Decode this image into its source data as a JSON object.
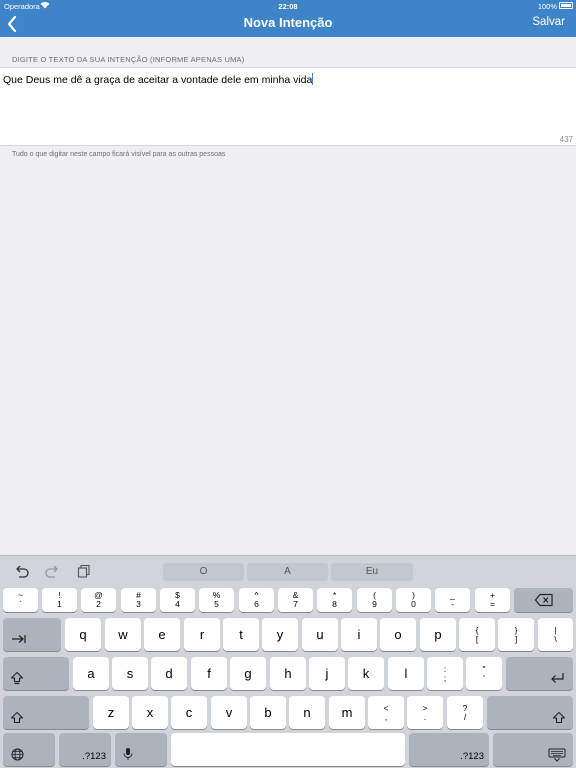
{
  "status_bar": {
    "carrier": "Operadora",
    "time": "22:08",
    "battery_percent": "100%"
  },
  "nav_bar": {
    "title": "Nova Intenção",
    "save_label": "Salvar"
  },
  "form": {
    "field_label": "DIGITE O TEXTO DA SUA INTENÇÃO (INFORME APENAS UMA)",
    "text_value": "Que Deus me dê a graça de aceitar a vontade dele em minha vida",
    "char_remaining": "437",
    "helper_text": "Tudo o que digitar neste campo ficará visível para as outras pessoas"
  },
  "keyboard": {
    "suggestions": [
      "O",
      "A",
      "Eu"
    ],
    "number_row": [
      {
        "top": "~",
        "bottom": "`"
      },
      {
        "top": "!",
        "bottom": "1"
      },
      {
        "top": "@",
        "bottom": "2"
      },
      {
        "top": "#",
        "bottom": "3"
      },
      {
        "top": "$",
        "bottom": "4"
      },
      {
        "top": "%",
        "bottom": "5"
      },
      {
        "top": "^",
        "bottom": "6"
      },
      {
        "top": "&",
        "bottom": "7"
      },
      {
        "top": "*",
        "bottom": "8"
      },
      {
        "top": "(",
        "bottom": "9"
      },
      {
        "top": ")",
        "bottom": "0"
      },
      {
        "top": "_",
        "bottom": "-"
      },
      {
        "top": "+",
        "bottom": "="
      }
    ],
    "row_q": [
      "q",
      "w",
      "e",
      "r",
      "t",
      "y",
      "u",
      "i",
      "o",
      "p"
    ],
    "row_q_extra": [
      {
        "top": "{",
        "bottom": "["
      },
      {
        "top": "}",
        "bottom": "]"
      },
      {
        "top": "|",
        "bottom": "\\"
      }
    ],
    "row_a": [
      "a",
      "s",
      "d",
      "f",
      "g",
      "h",
      "j",
      "k",
      "l"
    ],
    "row_a_extra": [
      {
        "top": ":",
        "bottom": ";"
      },
      {
        "top": "\"",
        "bottom": "'"
      }
    ],
    "row_z": [
      "z",
      "x",
      "c",
      "v",
      "b",
      "n",
      "m"
    ],
    "row_z_extra": [
      {
        "top": "<",
        "bottom": ","
      },
      {
        "top": ">",
        "bottom": "."
      },
      {
        "top": "?",
        "bottom": "/"
      }
    ],
    "numbers_label": ".?123"
  }
}
